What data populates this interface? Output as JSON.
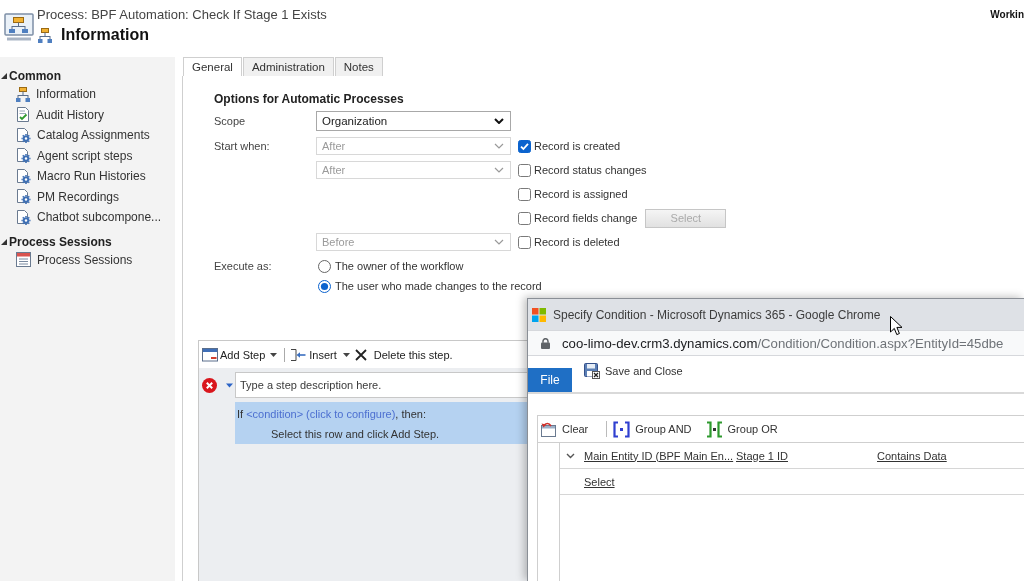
{
  "header": {
    "title": "Process: BPF Automation: Check If Stage 1 Exists",
    "subtitle": "Information",
    "status": "Workin"
  },
  "sidebar": {
    "sections": [
      {
        "label": "Common",
        "expanded": true,
        "items": [
          {
            "label": "Information",
            "kind": "process"
          },
          {
            "label": "Audit History",
            "kind": "audit"
          },
          {
            "label": "Catalog Assignments",
            "kind": "related"
          },
          {
            "label": "Agent script steps",
            "kind": "related"
          },
          {
            "label": "Macro Run Histories",
            "kind": "related"
          },
          {
            "label": "PM Recordings",
            "kind": "related"
          },
          {
            "label": "Chatbot subcompone...",
            "kind": "related"
          }
        ]
      },
      {
        "label": "Process Sessions",
        "expanded": true,
        "items": [
          {
            "label": "Process Sessions",
            "kind": "sessions"
          }
        ]
      }
    ]
  },
  "tabs": [
    {
      "label": "General",
      "selected": true
    },
    {
      "label": "Administration",
      "selected": false
    },
    {
      "label": "Notes",
      "selected": false
    }
  ],
  "options": {
    "heading": "Options for Automatic Processes",
    "scope": {
      "label": "Scope",
      "value": "Organization",
      "disabled": false
    },
    "start_when": {
      "label": "Start when:",
      "rows": [
        {
          "stage": {
            "value": "After",
            "disabled": true
          },
          "event": {
            "label": "Record is created",
            "checked": true
          }
        },
        {
          "stage": {
            "value": "After",
            "disabled": true
          },
          "event": {
            "label": "Record status changes",
            "checked": false
          }
        },
        {
          "event": {
            "label": "Record is assigned",
            "checked": false
          }
        },
        {
          "event": {
            "label": "Record fields change",
            "checked": false
          },
          "button": {
            "label": "Select",
            "disabled": true
          }
        },
        {
          "stage": {
            "value": "Before",
            "disabled": true
          },
          "event": {
            "label": "Record is deleted",
            "checked": false
          }
        }
      ]
    },
    "execute_as": {
      "label": "Execute as:",
      "options": [
        {
          "label": "The owner of the workflow",
          "selected": false
        },
        {
          "label": "The user who made changes to the record",
          "selected": true
        }
      ]
    }
  },
  "step_editor": {
    "toolbar": [
      {
        "label": "Add Step",
        "kind": "add",
        "dropdown": true
      },
      {
        "label": "Insert",
        "kind": "insert",
        "dropdown": true
      },
      {
        "label": "Delete this step.",
        "kind": "delete",
        "dropdown": false
      }
    ],
    "step": {
      "error": true,
      "expanded": true,
      "placeholder": "Type a step description here.",
      "condition": {
        "before": "If",
        "link": "<condition> (click to configure)",
        "after": ", then:"
      },
      "hint": "Select this row and click Add Step."
    }
  },
  "popup": {
    "title": "Specify Condition - Microsoft Dynamics 365 - Google Chrome",
    "url": {
      "host": "coo-limo-dev.crm3.dynamics.com",
      "path": "/Condition/Condition.aspx?EntityId=45dbe"
    },
    "ribbon": {
      "tab": "File",
      "action": "Save and Close"
    },
    "toolbar": [
      {
        "label": "Clear",
        "kind": "clear"
      },
      {
        "label": "Group AND",
        "kind": "and"
      },
      {
        "label": "Group OR",
        "kind": "or"
      }
    ],
    "rows": [
      {
        "kind": "clause",
        "expanded": true,
        "field": "Main Entity ID (BPF Main En...",
        "attribute": "Stage 1 ID",
        "operator": "Contains Data"
      },
      {
        "kind": "add",
        "label": "Select"
      }
    ]
  }
}
